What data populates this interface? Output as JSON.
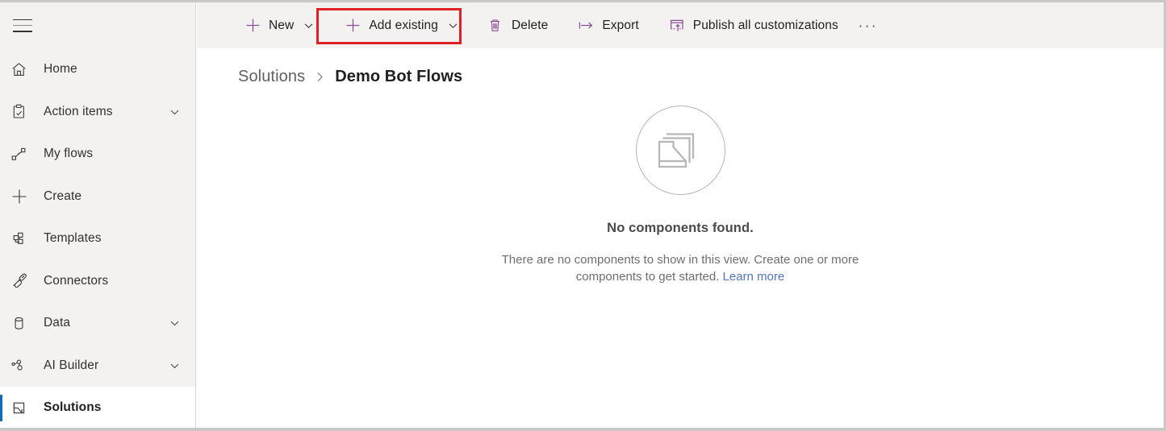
{
  "sidebar": {
    "menu_icon": "hamburger-icon",
    "items": [
      {
        "label": "Home",
        "icon": "home-icon",
        "has_chevron": false,
        "selected": false
      },
      {
        "label": "Action items",
        "icon": "clipboard-check-icon",
        "has_chevron": true,
        "selected": false
      },
      {
        "label": "My flows",
        "icon": "flow-icon",
        "has_chevron": false,
        "selected": false
      },
      {
        "label": "Create",
        "icon": "plus-icon",
        "has_chevron": false,
        "selected": false
      },
      {
        "label": "Templates",
        "icon": "templates-icon",
        "has_chevron": false,
        "selected": false
      },
      {
        "label": "Connectors",
        "icon": "connectors-icon",
        "has_chevron": false,
        "selected": false
      },
      {
        "label": "Data",
        "icon": "database-icon",
        "has_chevron": true,
        "selected": false
      },
      {
        "label": "AI Builder",
        "icon": "ai-builder-icon",
        "has_chevron": true,
        "selected": false
      },
      {
        "label": "Solutions",
        "icon": "solutions-icon",
        "has_chevron": false,
        "selected": true
      }
    ]
  },
  "toolbar": {
    "new_label": "New",
    "add_existing_label": "Add existing",
    "delete_label": "Delete",
    "export_label": "Export",
    "publish_label": "Publish all customizations",
    "overflow_label": "···",
    "highlighted_command": "Add existing",
    "icons": {
      "new": "plus-icon",
      "add_existing": "plus-icon",
      "delete": "trash-icon",
      "export": "export-arrow-icon",
      "publish": "publish-upload-icon",
      "overflow": "more-horizontal-icon",
      "caret": "chevron-down-icon"
    }
  },
  "breadcrumb": {
    "root": "Solutions",
    "separator": "›",
    "current": "Demo Bot Flows"
  },
  "empty_state": {
    "icon": "stacked-documents-icon",
    "title": "No components found.",
    "description": "There are no components to show in this view. Create one or more components to get started.",
    "link_text": "Learn more"
  },
  "colors": {
    "accent_purple": "#8a4c94",
    "highlight_red": "#e02027",
    "selected_blue": "#0f6cbd",
    "link_blue": "#4f77bb",
    "chrome_gray": "#f3f2f1"
  }
}
